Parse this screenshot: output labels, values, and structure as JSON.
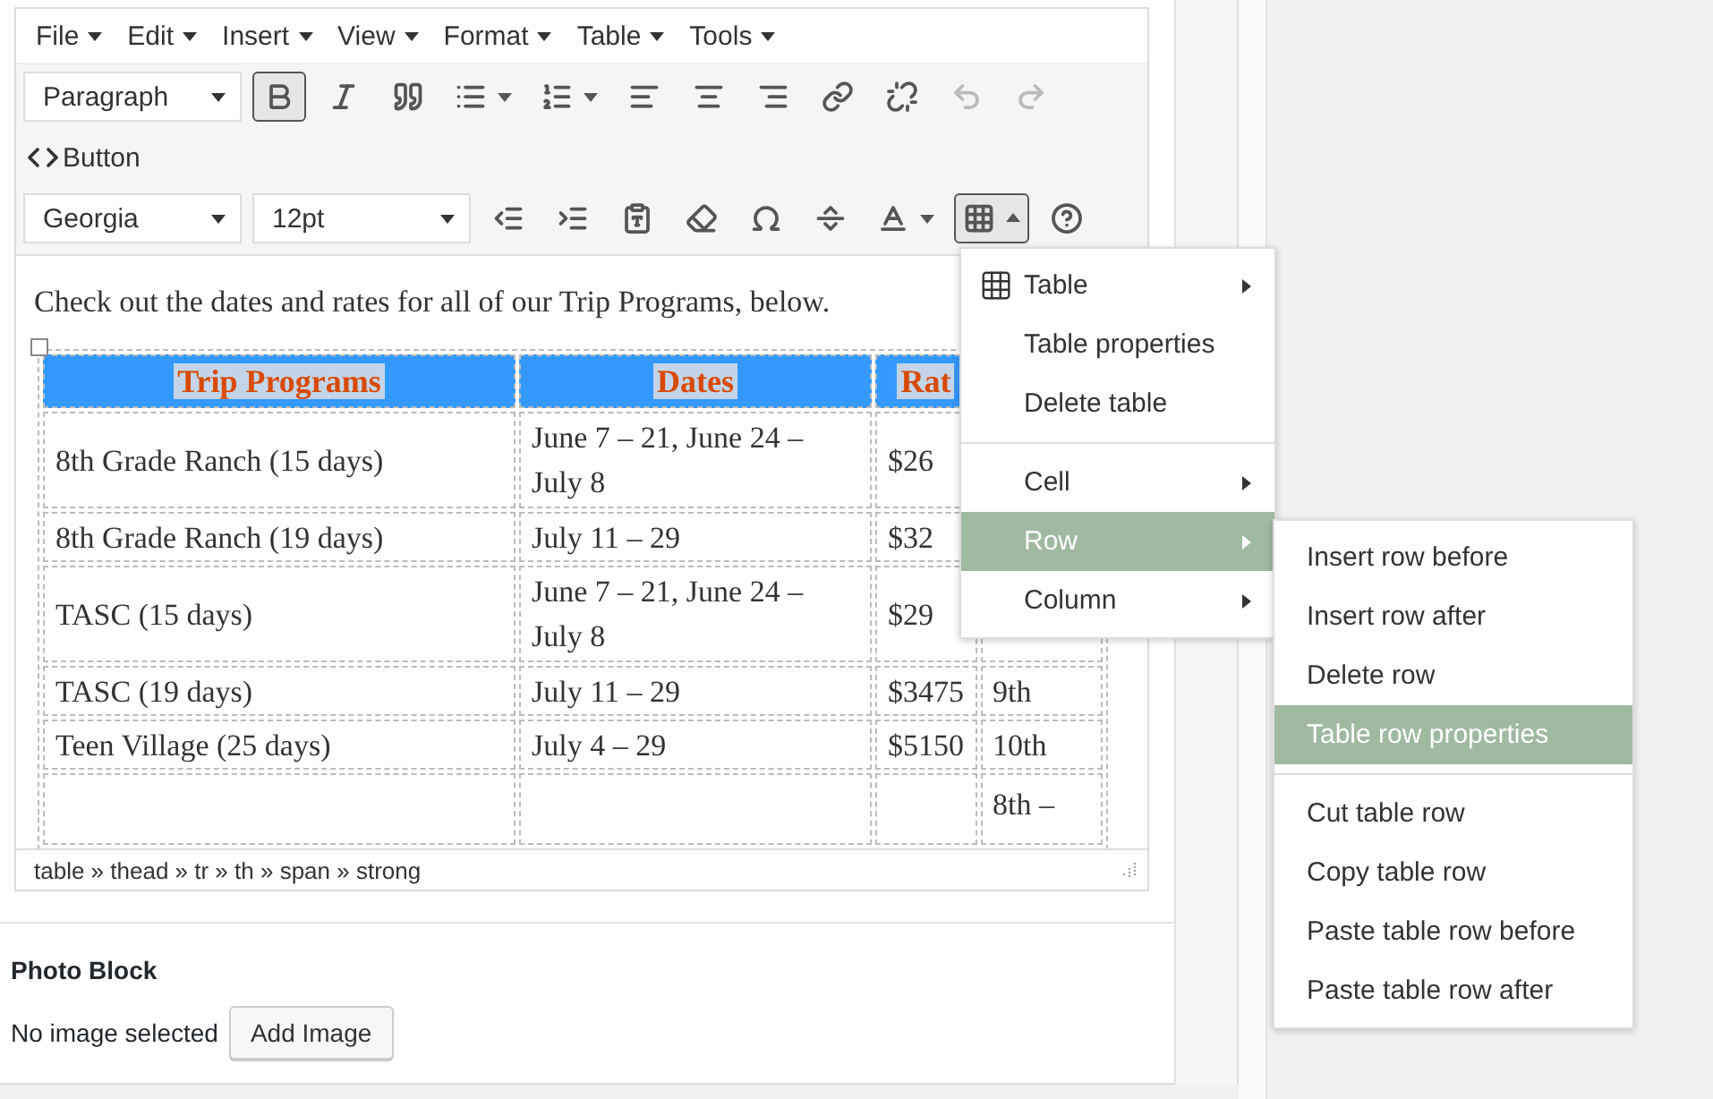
{
  "menubar": [
    {
      "label": "File"
    },
    {
      "label": "Edit"
    },
    {
      "label": "Insert"
    },
    {
      "label": "View"
    },
    {
      "label": "Format"
    },
    {
      "label": "Table"
    },
    {
      "label": "Tools"
    }
  ],
  "toolbar_row_1": [
    {
      "kind": "select",
      "value": "Paragraph"
    },
    {
      "kind": "bold",
      "active": true
    },
    {
      "kind": "italic",
      "active": false
    },
    {
      "kind": "quote",
      "active": false
    },
    {
      "kind": "bullets",
      "active": false
    },
    {
      "kind": "numbers",
      "active": false
    },
    {
      "kind": "align-left",
      "active": false
    },
    {
      "kind": "align-center",
      "active": false
    },
    {
      "kind": "align-right",
      "active": false
    },
    {
      "kind": "link",
      "active": false
    },
    {
      "kind": "unlink",
      "active": false
    },
    {
      "kind": "undo",
      "disabled": true
    },
    {
      "kind": "redo",
      "disabled": true
    }
  ],
  "toolbar_row_2": [
    {
      "kind": "code-button",
      "label": "Button"
    }
  ],
  "toolbar_row_3": [
    {
      "kind": "select",
      "value": "Georgia"
    },
    {
      "kind": "select-wide",
      "value": "12pt"
    },
    {
      "kind": "outdent",
      "active": false
    },
    {
      "kind": "indent",
      "active": false
    },
    {
      "kind": "paste-text",
      "active": false
    },
    {
      "kind": "eraser",
      "active": false
    },
    {
      "kind": "omega",
      "active": false
    },
    {
      "kind": "page-break",
      "active": false
    },
    {
      "kind": "text-color",
      "active": false
    },
    {
      "kind": "table",
      "active": true
    },
    {
      "kind": "help",
      "active": false
    }
  ],
  "content": {
    "intro": "Check out the dates and rates for all of our Trip Programs, below.",
    "table": {
      "columns": [
        "Trip Programs",
        "Dates",
        "Rat"
      ],
      "rows": [
        [
          "8th Grade Ranch (15 days)",
          "June 7 – 21, June 24 – July 8",
          "$26",
          ""
        ],
        [
          "8th Grade Ranch (19 days)",
          "July 11 – 29",
          "$32",
          ""
        ],
        [
          "TASC (15 days)",
          "June 7 – 21, June 24 – July 8",
          "$29",
          ""
        ],
        [
          "TASC (19 days)",
          "July 11 – 29",
          "$3475",
          "9th"
        ],
        [
          "Teen Village (25 days)",
          "July 4 – 29",
          "$5150",
          "10th"
        ],
        [
          "",
          "",
          "",
          "8th –"
        ]
      ]
    }
  },
  "status_bar": {
    "path": "table » thead » tr » th » span » strong"
  },
  "photo_block": {
    "title": "Photo Block",
    "status": "No image selected",
    "button": "Add Image"
  },
  "context_menu": {
    "groups": [
      [
        {
          "label": "Table",
          "submenu": true,
          "icon": true,
          "selected": false
        },
        {
          "label": "Table properties",
          "submenu": false,
          "selected": false
        },
        {
          "label": "Delete table",
          "submenu": false,
          "selected": false
        }
      ],
      [
        {
          "label": "Cell",
          "submenu": true,
          "selected": false
        },
        {
          "label": "Row",
          "submenu": true,
          "selected": true
        },
        {
          "label": "Column",
          "submenu": true,
          "selected": false
        }
      ]
    ]
  },
  "submenu": {
    "groups": [
      [
        {
          "label": "Insert row before",
          "selected": false
        },
        {
          "label": "Insert row after",
          "selected": false
        },
        {
          "label": "Delete row",
          "selected": false
        },
        {
          "label": "Table row properties",
          "selected": true
        }
      ],
      [
        {
          "label": "Cut table row",
          "selected": false
        },
        {
          "label": "Copy table row",
          "selected": false
        },
        {
          "label": "Paste table row before",
          "selected": false
        },
        {
          "label": "Paste table row after",
          "selected": false
        }
      ]
    ]
  }
}
